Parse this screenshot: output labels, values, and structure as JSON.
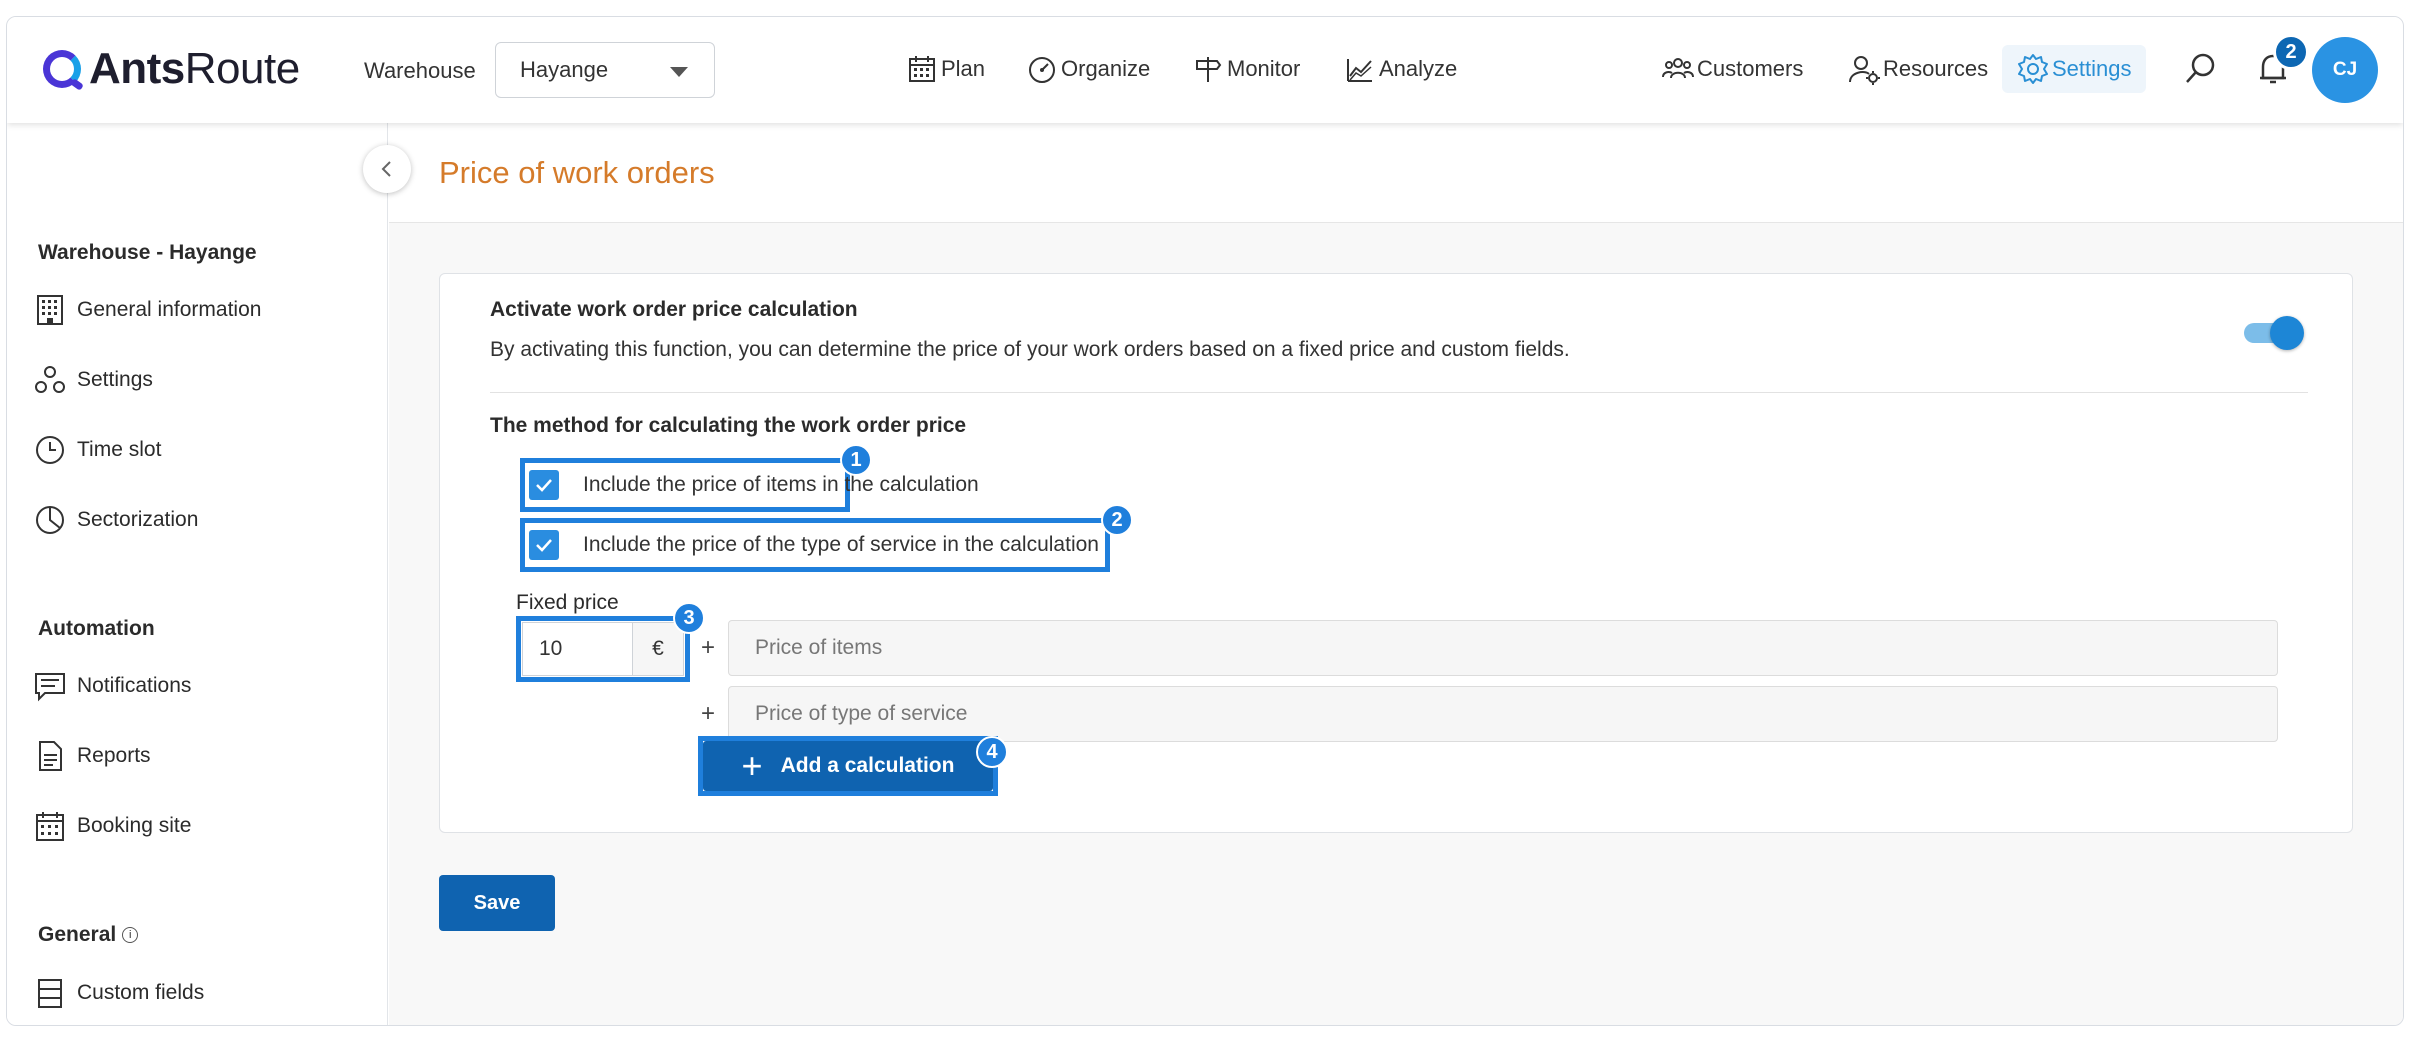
{
  "app": {
    "logo_bold": "Ants",
    "logo_light": "Route",
    "warehouse_label": "Warehouse",
    "warehouse_value": "Hayange"
  },
  "nav": {
    "plan": "Plan",
    "organize": "Organize",
    "monitor": "Monitor",
    "analyze": "Analyze",
    "customers": "Customers",
    "resources": "Resources",
    "settings": "Settings",
    "notification_count": "2",
    "avatar_initials": "CJ"
  },
  "sidebar": {
    "section_warehouse": "Warehouse - Hayange",
    "general_information": "General information",
    "settings": "Settings",
    "time_slot": "Time slot",
    "sectorization": "Sectorization",
    "section_automation": "Automation",
    "notifications": "Notifications",
    "reports": "Reports",
    "booking_site": "Booking site",
    "section_general": "General",
    "custom_fields": "Custom fields"
  },
  "page": {
    "title": "Price of work orders",
    "activate_title": "Activate work order price calculation",
    "activate_desc": "By activating this function, you can determine the price of your work orders based on a fixed price and custom fields.",
    "toggle_on": true,
    "method_title": "The method for calculating the work order price",
    "include_items": "Include the price of items in the calculation",
    "include_service": "Include the price of the type of service in the calculation",
    "fixed_price_label": "Fixed price",
    "fixed_price_value": "10",
    "currency": "€",
    "plus": "+",
    "field_items": "Price of items",
    "field_service": "Price of type of service",
    "add_calculation": "Add a calculation",
    "save": "Save"
  },
  "annotations": [
    "1",
    "2",
    "3",
    "4"
  ],
  "colors": {
    "accent": "#1f7fdc",
    "primary_button": "#0f63b0",
    "title_orange": "#d57b2a",
    "logo_purple": "#4a35d6"
  }
}
